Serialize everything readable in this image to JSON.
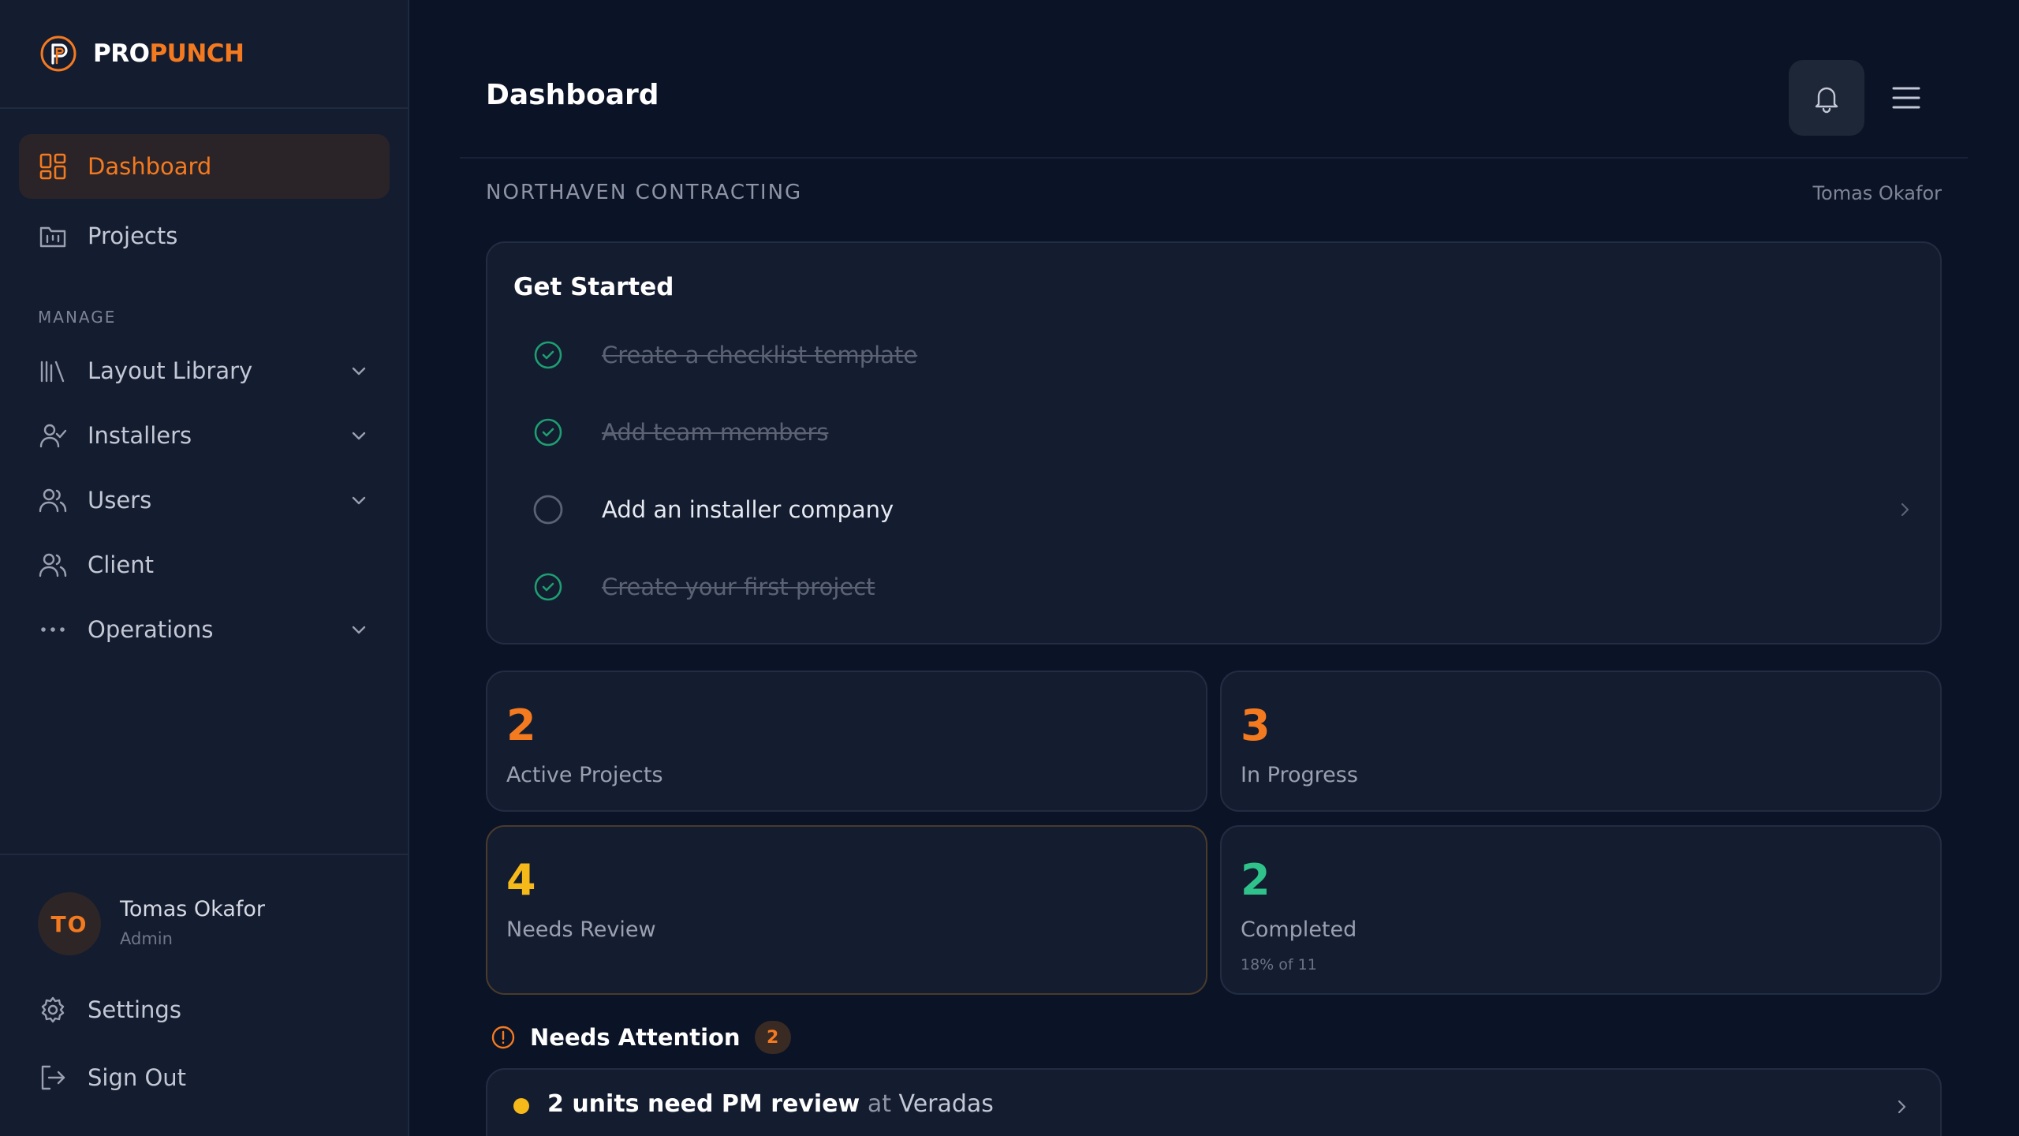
{
  "brand": {
    "pro": "PRO",
    "punch": "PUNCH",
    "accent": "#f47a20"
  },
  "sidebar": {
    "items": [
      {
        "label": "Dashboard",
        "icon": "dashboard-grid-icon",
        "active": true
      },
      {
        "label": "Projects",
        "icon": "projects-folder-icon",
        "active": false
      }
    ],
    "section_label": "MANAGE",
    "manage_items": [
      {
        "label": "Layout Library",
        "icon": "library-icon",
        "has_chevron": true
      },
      {
        "label": "Installers",
        "icon": "installer-user-check-icon",
        "has_chevron": true
      },
      {
        "label": "Users",
        "icon": "users-icon",
        "has_chevron": true
      },
      {
        "label": "Client",
        "icon": "client-users-icon",
        "has_chevron": false
      },
      {
        "label": "Operations",
        "icon": "more-dots-icon",
        "has_chevron": true
      }
    ],
    "user": {
      "initials": "TO",
      "name": "Tomas Okafor",
      "role": "Admin"
    },
    "footer_items": [
      {
        "label": "Settings",
        "icon": "gear-icon"
      },
      {
        "label": "Sign Out",
        "icon": "sign-out-icon"
      }
    ]
  },
  "header": {
    "title": "Dashboard"
  },
  "org": {
    "name": "NORTHAVEN CONTRACTING",
    "user": "Tomas Okafor"
  },
  "get_started": {
    "title": "Get Started",
    "items": [
      {
        "label": "Create a checklist template",
        "done": true
      },
      {
        "label": "Add team members",
        "done": true
      },
      {
        "label": "Add an installer company",
        "done": false
      },
      {
        "label": "Create your first project",
        "done": true
      }
    ]
  },
  "stats": [
    {
      "value": "2",
      "label": "Active Projects",
      "color": "#f47a20",
      "sub": ""
    },
    {
      "value": "3",
      "label": "In Progress",
      "color": "#f47a20",
      "sub": ""
    },
    {
      "value": "4",
      "label": "Needs Review",
      "color": "#f5b91a",
      "sub": ""
    },
    {
      "value": "2",
      "label": "Completed",
      "color": "#2fc28a",
      "sub": "18% of 11"
    }
  ],
  "attention": {
    "title": "Needs Attention",
    "count": "2",
    "items": [
      {
        "strong": "2 units need PM review",
        "at": "at",
        "project": "Veradas"
      }
    ]
  }
}
